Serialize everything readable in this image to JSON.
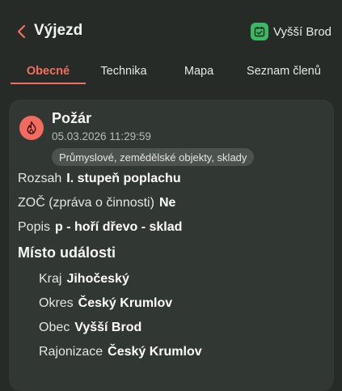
{
  "header": {
    "title": "Výjezd",
    "station": "Vyšší Brod",
    "back_icon": "chevron-left-icon",
    "station_icon": "calendar-check-icon"
  },
  "tabs": [
    {
      "label": "Obecné",
      "active": true
    },
    {
      "label": "Technika",
      "active": false
    },
    {
      "label": "Mapa",
      "active": false
    },
    {
      "label": "Seznam členů",
      "active": false
    }
  ],
  "event": {
    "type": "Požár",
    "timestamp": "05.03.2026 11:29:59",
    "category": "Průmyslové, zemědělské objekty, sklady",
    "icon": "fire-icon"
  },
  "details": [
    {
      "label": "Rozsah",
      "value": "I. stupeň poplachu"
    },
    {
      "label": "ZOČ (zpráva o činnosti)",
      "value": "Ne"
    },
    {
      "label": "Popis",
      "value": "p - hoří dřevo - sklad"
    }
  ],
  "location": {
    "title": "Místo události",
    "fields": [
      {
        "label": "Kraj",
        "value": "Jihočeský"
      },
      {
        "label": "Okres",
        "value": "Český Krumlov"
      },
      {
        "label": "Obec",
        "value": "Vyšší Brod"
      },
      {
        "label": "Rajonizace",
        "value": "Český Krumlov"
      }
    ]
  },
  "colors": {
    "background": "#262b28",
    "card": "#313733",
    "accent": "#f46f5e",
    "station_icon": "#3bb863"
  }
}
